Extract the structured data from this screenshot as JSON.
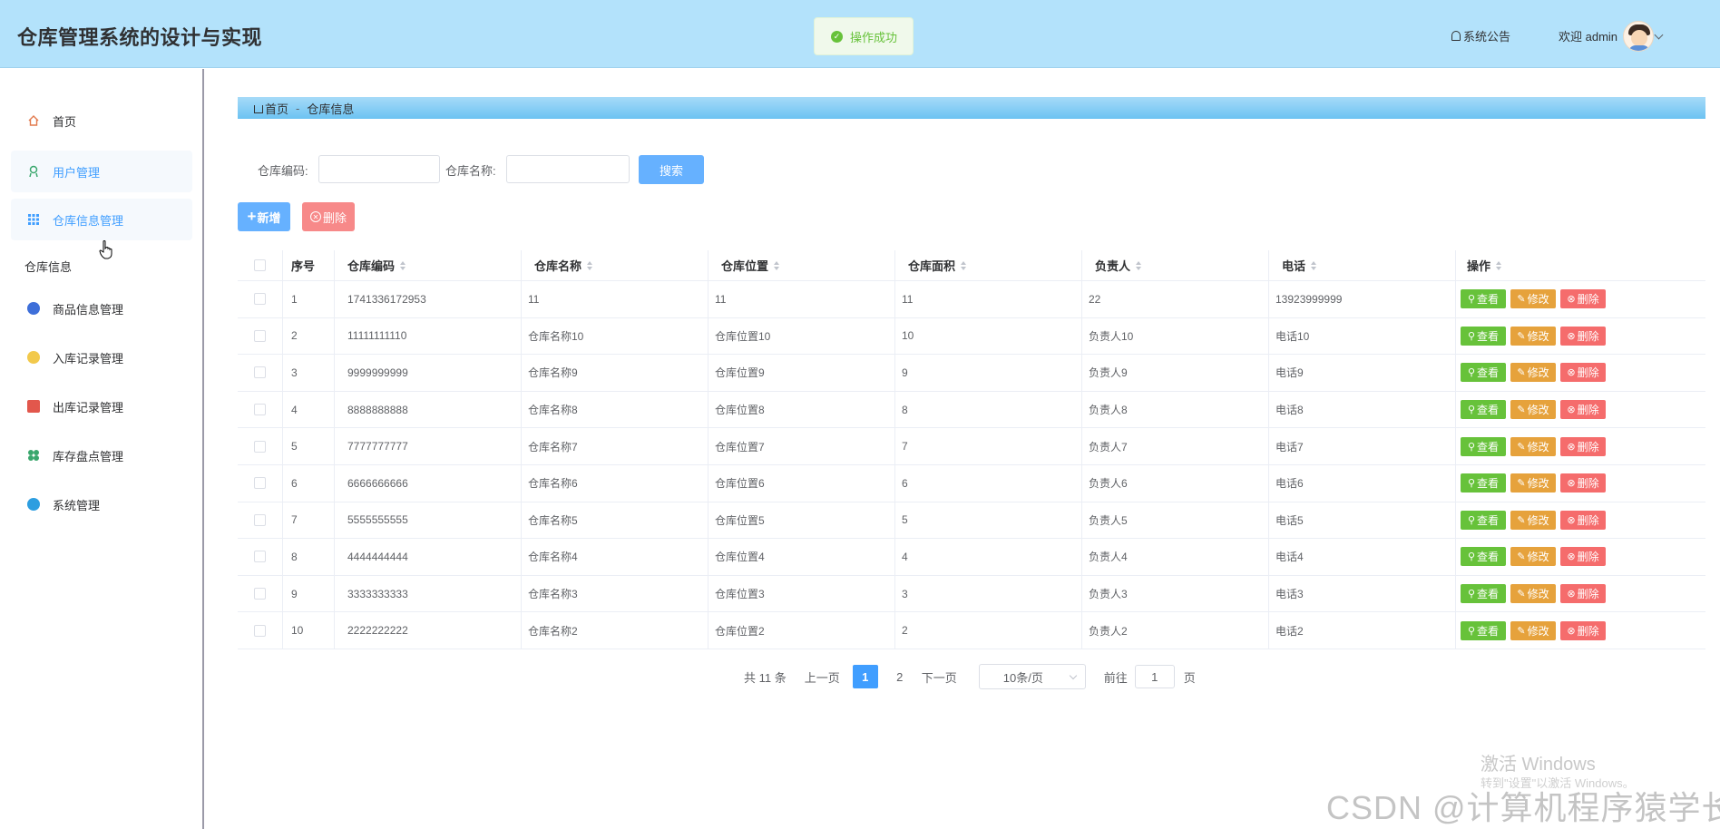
{
  "header": {
    "app_title": "仓库管理系统的设计与实现",
    "toast": "操作成功",
    "notice": "系统公告",
    "welcome": "欢迎 admin"
  },
  "sidebar": {
    "items": [
      {
        "label": "首页",
        "icon": "home-icon"
      },
      {
        "label": "用户管理",
        "icon": "user-icon"
      },
      {
        "label": "仓库信息管理",
        "icon": "grid-icon"
      }
    ],
    "group": "仓库信息",
    "group_items": [
      {
        "label": "商品信息管理",
        "icon": "product-icon"
      },
      {
        "label": "入库记录管理",
        "icon": "inbound-icon"
      },
      {
        "label": "出库记录管理",
        "icon": "outbound-icon"
      },
      {
        "label": "库存盘点管理",
        "icon": "inventory-icon"
      },
      {
        "label": "系统管理",
        "icon": "settings-icon"
      }
    ]
  },
  "breadcrumb": {
    "home": "首页",
    "sep": "-",
    "current": "仓库信息"
  },
  "search": {
    "code_label": "仓库编码:",
    "code_value": "",
    "name_label": "仓库名称:",
    "name_value": "",
    "search_btn": "搜索"
  },
  "toolbar": {
    "add": "新增",
    "delete": "删除"
  },
  "table": {
    "columns": [
      "序号",
      "仓库编码",
      "仓库名称",
      "仓库位置",
      "仓库面积",
      "负责人",
      "电话",
      "操作"
    ],
    "actions": {
      "view": "查看",
      "edit": "修改",
      "delete": "删除"
    },
    "rows": [
      [
        "1",
        "1741336172953",
        "11",
        "11",
        "11",
        "22",
        "13923999999"
      ],
      [
        "2",
        "11111111110",
        "仓库名称10",
        "仓库位置10",
        "10",
        "负责人10",
        "电话10"
      ],
      [
        "3",
        "9999999999",
        "仓库名称9",
        "仓库位置9",
        "9",
        "负责人9",
        "电话9"
      ],
      [
        "4",
        "8888888888",
        "仓库名称8",
        "仓库位置8",
        "8",
        "负责人8",
        "电话8"
      ],
      [
        "5",
        "7777777777",
        "仓库名称7",
        "仓库位置7",
        "7",
        "负责人7",
        "电话7"
      ],
      [
        "6",
        "6666666666",
        "仓库名称6",
        "仓库位置6",
        "6",
        "负责人6",
        "电话6"
      ],
      [
        "7",
        "5555555555",
        "仓库名称5",
        "仓库位置5",
        "5",
        "负责人5",
        "电话5"
      ],
      [
        "8",
        "4444444444",
        "仓库名称4",
        "仓库位置4",
        "4",
        "负责人4",
        "电话4"
      ],
      [
        "9",
        "3333333333",
        "仓库名称3",
        "仓库位置3",
        "3",
        "负责人3",
        "电话3"
      ],
      [
        "10",
        "2222222222",
        "仓库名称2",
        "仓库位置2",
        "2",
        "负责人2",
        "电话2"
      ]
    ]
  },
  "pagination": {
    "total": "共 11 条",
    "prev": "上一页",
    "pages": [
      "1",
      "2"
    ],
    "current": "1",
    "next": "下一页",
    "page_size": "10条/页",
    "goto_label": "前往",
    "goto_value": "1",
    "goto_suffix": "页"
  },
  "watermarks": {
    "windows": "激活 Windows",
    "windows_sub": "转到\"设置\"以激活 Windows。",
    "csdn": "CSDN @计算机程序猿学长"
  },
  "colors": {
    "header_bg": "#b3e2fb",
    "primary": "#409eff",
    "success": "#67c23a",
    "warning": "#e6a23c",
    "danger": "#f56c6c"
  }
}
